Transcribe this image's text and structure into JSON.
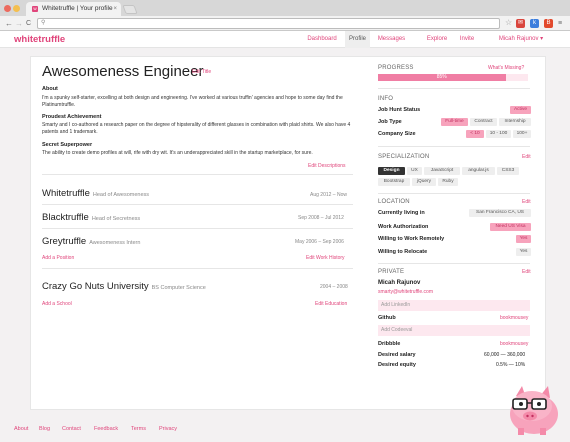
{
  "browser": {
    "tab_title": "Whitetruffle | Your profile",
    "tab_favicon": "w",
    "close_glyph": "×",
    "menu_glyph": "≡",
    "back_glyph": "←",
    "forward_glyph": "→",
    "reload_glyph": "C",
    "search_glyph": "⚲",
    "star_glyph": "☆",
    "ext1": "✉",
    "ext2": "k",
    "ext3": "B",
    "address": ""
  },
  "header": {
    "logo": "whitetruffle",
    "nav": [
      "Dashboard",
      "Profile",
      "Messages",
      "Explore",
      "Invite",
      "Micah Rajunov ▾"
    ]
  },
  "profile": {
    "title": "Awesomeness Engineer",
    "edit_title": "Edit Title",
    "about_label": "About",
    "about_text": "I'm a spunky self-starter, excelling at both design and engineering. I've worked at various truffin' agencies and hope to some day find the Platinumtruffle.",
    "achievement_label": "Proudest Achievement",
    "achievement_text": "Smarty and I co-authored a research paper on the degree of hipsterality of different glasses in combination with plaid shirts. We also have 4 patents and 1 trademark.",
    "superpower_label": "Secret Superpower",
    "superpower_text": "The ability to create demo profiles at will, rife with dry wit. It's an underappreciated skill in the startup marketplace, for sure.",
    "edit_descriptions": "Edit Descriptions"
  },
  "work": [
    {
      "company": "Whitetruffle",
      "role": "Head of Awesomeness",
      "dates": "Aug 2012 – Now"
    },
    {
      "company": "Blacktruffle",
      "role": "Head of Secretness",
      "dates": "Sep 2008 – Jul 2012"
    },
    {
      "company": "Greytruffle",
      "role": "Awesomeness Intern",
      "dates": "May 2006 – Sep 2006"
    }
  ],
  "work_links": {
    "add": "Add a Position",
    "edit": "Edit Work History"
  },
  "education": [
    {
      "school": "Crazy Go Nuts University",
      "degree": "BS Computer Science",
      "dates": "2004 – 2008"
    }
  ],
  "education_links": {
    "add": "Add a School",
    "edit": "Edit Education"
  },
  "sidebar": {
    "progress_label": "PROGRESS",
    "whats_missing": "What's Missing?",
    "progress_value": 85,
    "progress_text": "85%",
    "info_label": "INFO",
    "job_hunt_status_label": "Job Hunt Status",
    "job_hunt_status": "Active",
    "job_type_label": "Job Type",
    "job_types": [
      "Full-time",
      "Contract",
      "Internship"
    ],
    "company_size_label": "Company Size",
    "company_sizes": [
      "< 10",
      "10 - 100",
      "100+"
    ],
    "specialization_label": "SPECIALIZATION",
    "edit": "Edit",
    "skills": [
      "Design",
      "UX",
      "JavaScript",
      "angular.js",
      "CSS3",
      "Bootstrap",
      "jQuery",
      "Ruby"
    ],
    "location_label": "LOCATION",
    "living_label": "Currently living in",
    "living": "San Francisco CA, US",
    "work_auth_label": "Work Authorization",
    "work_auth": "Need US Visa",
    "remote_label": "Willing to Work Remotely",
    "remote": "Yes",
    "relocate_label": "Willing to Relocate",
    "relocate": "Yes",
    "private_label": "PRIVATE",
    "name": "Micah Rajunov",
    "email": "smarty@whitetruffle.com",
    "add_linkedin": "Add LinkedIn",
    "github_label": "Github",
    "github": "bookmousey",
    "add_codeeval": "Add Codeeval",
    "dribbble_label": "Dribbble",
    "dribbble": "bookmousey",
    "salary_label": "Desired salary",
    "salary": "60,000 — 360,000",
    "equity_label": "Desired equity",
    "equity": "0.5% — 10%"
  },
  "footer": [
    "About",
    "Blog",
    "Contact",
    "Feedback",
    "Terms",
    "Privacy"
  ]
}
